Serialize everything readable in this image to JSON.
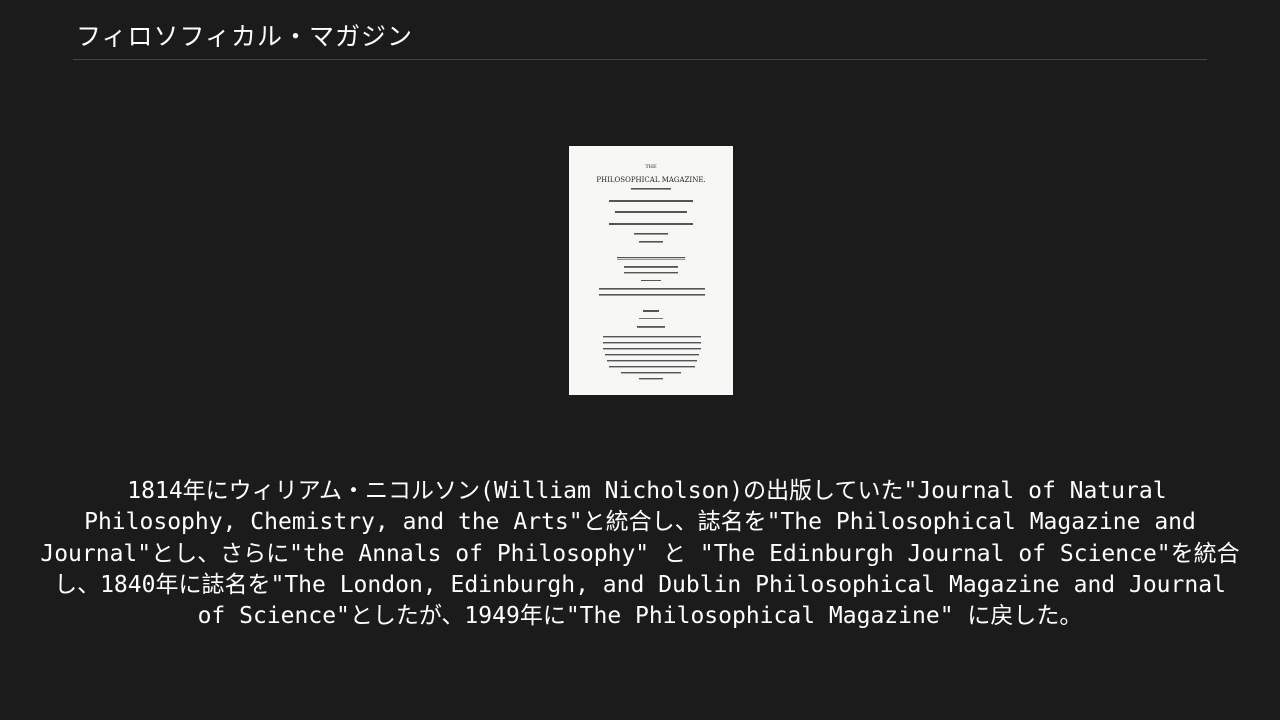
{
  "header": {
    "title": "フィロソフィカル・マガジン"
  },
  "cover_image": {
    "icon": "book-title-page-image",
    "lines": [
      "THE",
      "PHILOSOPHICAL MAGAZINE."
    ]
  },
  "caption": {
    "text": " 1814年にウィリアム・ニコルソン(William Nicholson)の出版していた\"Journal of Natural Philosophy, Chemistry, and the Arts\"と統合し、誌名を\"The Philosophical Magazine and Journal\"とし、さらに\"the Annals of Philosophy\" と \"The Edinburgh Journal of Science\"を統合し、1840年に誌名を\"The London, Edinburgh, and Dublin Philosophical Magazine and Journal of Science\"としたが、1949年に\"The Philosophical Magazine\" に戻した。"
  }
}
